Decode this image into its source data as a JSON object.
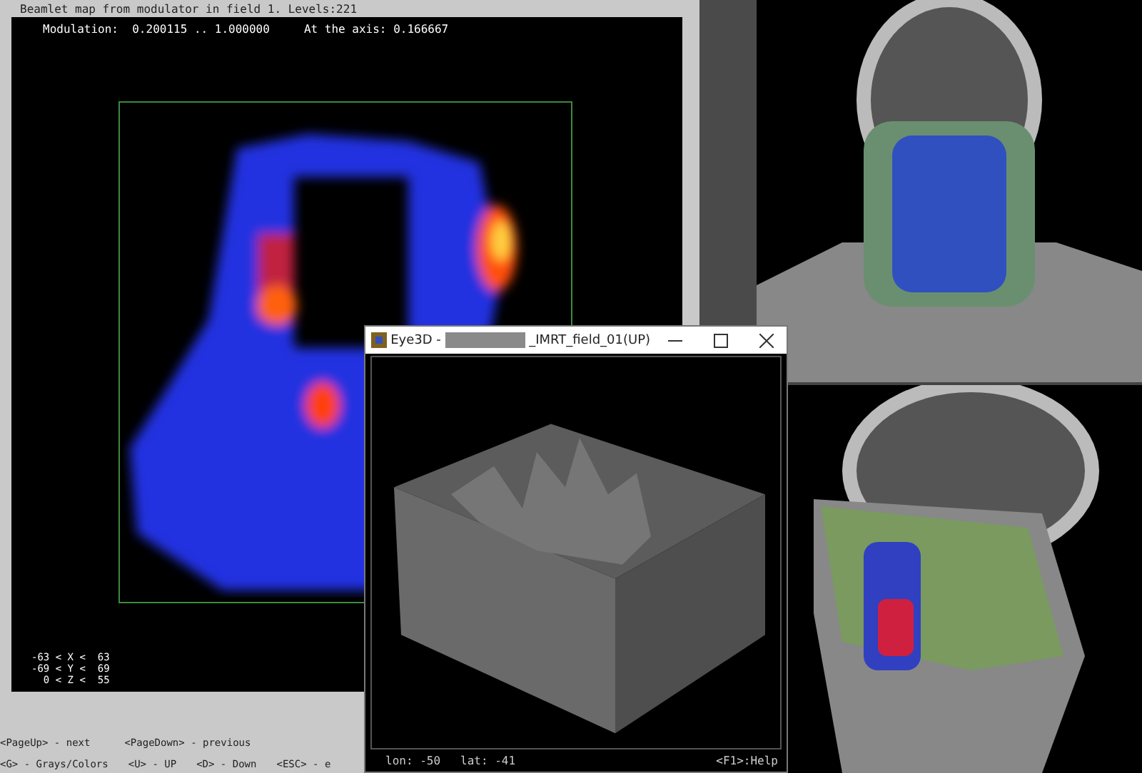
{
  "left_window": {
    "title": "Beamlet map from modulator in field 1. Levels:221",
    "modulation": "Modulation:  0.200115 .. 1.000000",
    "axis": "At the axis: 0.166667",
    "ranges": [
      "-63 < X <  63",
      "-69 < Y <  69",
      "  0 < Z <  55"
    ],
    "key_help": [
      [
        "<PageUp> - next",
        "<PageDown> - previous"
      ],
      [
        "<G> - Grays/Colors",
        "<U> - UP",
        "<D> - Down",
        "<ESC> - e"
      ]
    ]
  },
  "eye3d_window": {
    "title_prefix": "Eye3D -",
    "title_suffix": "_IMRT_field_01(UP)",
    "lon": "lon: -50",
    "lat": "lat: -41",
    "help": "<F1>:Help"
  }
}
